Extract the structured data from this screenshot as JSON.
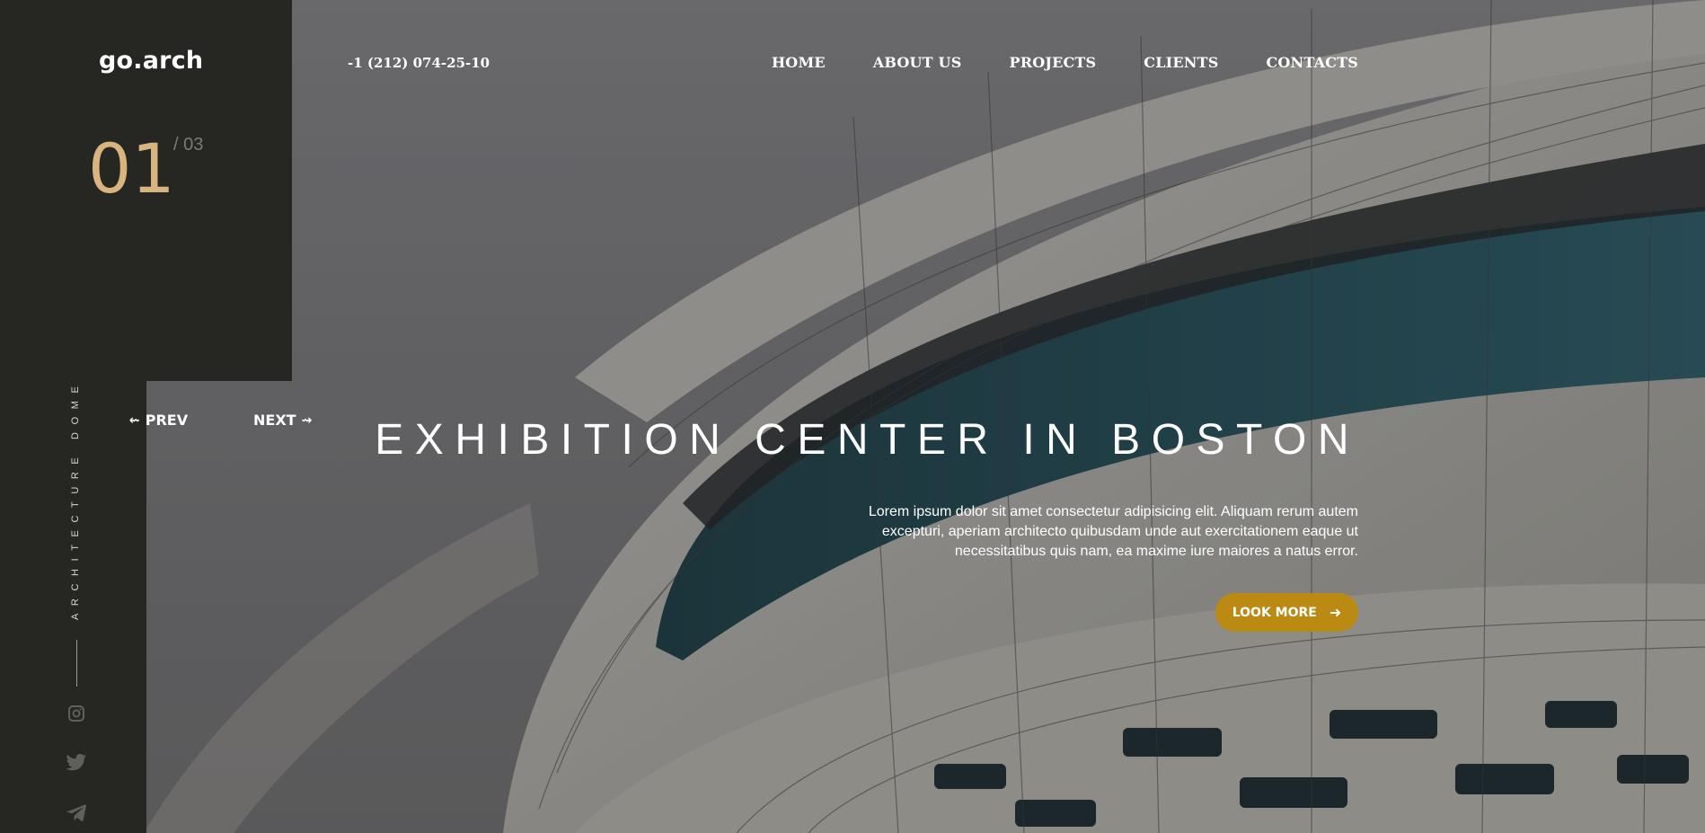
{
  "brand": {
    "logo": "go.arch"
  },
  "header": {
    "phone": "-1 (212) 074-25-10",
    "nav": [
      {
        "label": "HOME"
      },
      {
        "label": "ABOUT US"
      },
      {
        "label": "PROJECTS"
      },
      {
        "label": "CLIENTS"
      },
      {
        "label": "CONTACTS"
      }
    ]
  },
  "slider": {
    "current": "01",
    "total": "/ 03",
    "prev_label": "PREV",
    "next_label": "NEXT",
    "prev_icon": "arrow-left-icon",
    "next_icon": "arrow-right-icon",
    "category": "ARCHITECTURE DOME"
  },
  "hero": {
    "title": "EXHIBITION CENTER IN BOSTON",
    "description": "Lorem ipsum dolor sit amet consectetur adipisicing elit. Aliquam rerum autem excepturi, aperiam architecto quibusdam unde aut exercitationem eaque ut necessitatibus quis nam, ea maxime iure maiores a natus error.",
    "button_label": "LOOK MORE",
    "button_icon": "arrow-right-icon"
  },
  "social": [
    {
      "icon": "instagram-icon"
    },
    {
      "icon": "twitter-icon"
    },
    {
      "icon": "telegram-icon"
    }
  ],
  "colors": {
    "panel": "#262623",
    "accent_gold": "#d9b47e",
    "button": "#bb8a12",
    "text": "#ffffff"
  }
}
